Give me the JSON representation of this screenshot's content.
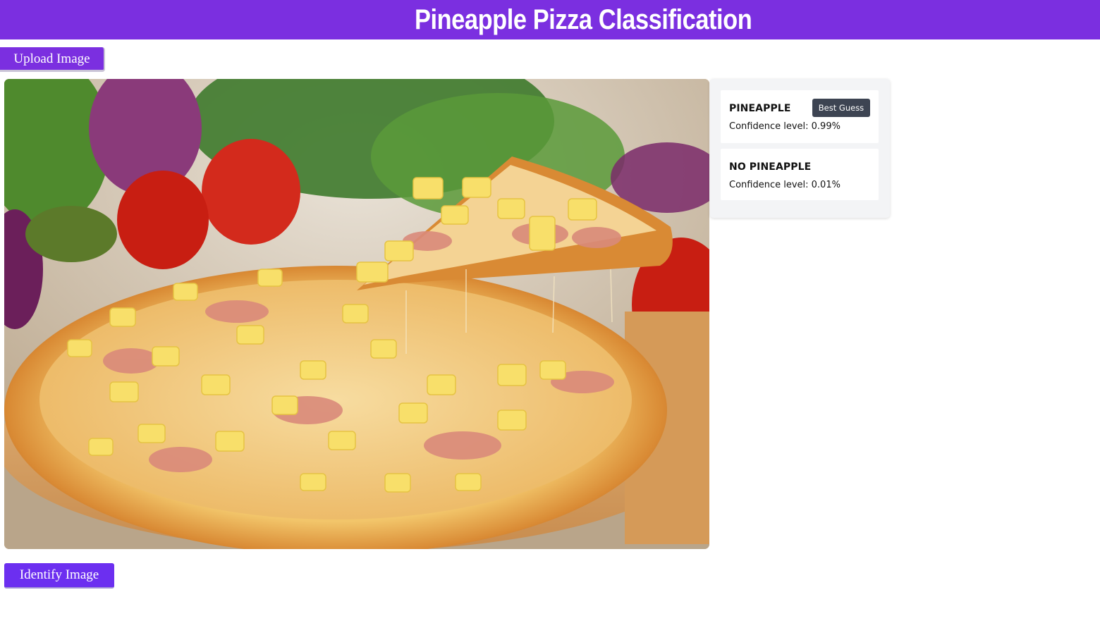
{
  "header": {
    "title": "Pineapple Pizza Classification",
    "background_color": "#7b2fe0"
  },
  "upload_button": {
    "label": "Upload Image"
  },
  "photo": {
    "subject": "pineapple-pizza-photo"
  },
  "results": [
    {
      "label": "PINEAPPLE",
      "confidence_text": "Confidence level: 0.99%",
      "badge": "Best Guess"
    },
    {
      "label": "NO PINEAPPLE",
      "confidence_text": "Confidence level: 0.01%"
    }
  ],
  "identify_button": {
    "label": "Identify Image"
  },
  "colors": {
    "accent": "#7b2fe0",
    "badge_bg": "#3d4452",
    "panel_bg": "#f3f4f6"
  }
}
